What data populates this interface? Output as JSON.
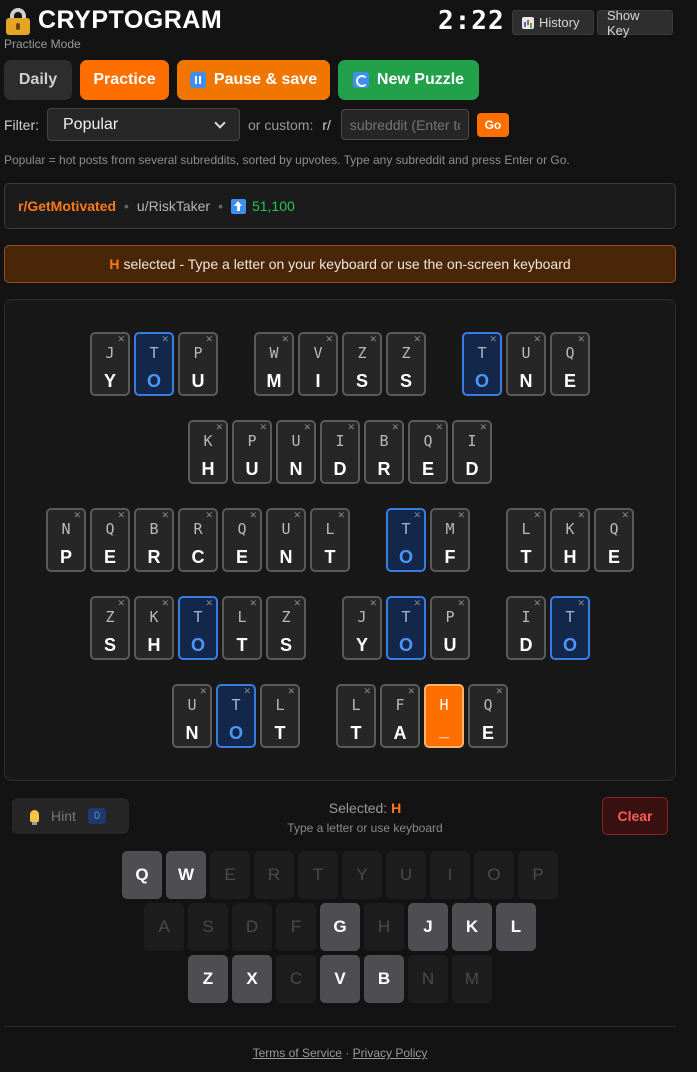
{
  "header": {
    "title": "CRYPTOGRAM",
    "mode_label": "Practice Mode",
    "timer": "2:22",
    "history_label": "History",
    "show_key_label": "Show Key"
  },
  "modes": {
    "daily": "Daily",
    "practice": "Practice",
    "pause_save": "Pause & save",
    "new_puzzle": "New Puzzle"
  },
  "filter": {
    "label": "Filter:",
    "selected": "Popular",
    "or_custom": "or custom:",
    "prefix": "r/",
    "custom_placeholder": "subreddit (Enter to",
    "go_label": "Go",
    "help_text": "Popular = hot posts from several subreddits, sorted by upvotes. Type any subreddit and press Enter or Go."
  },
  "post": {
    "subreddit": "r/GetMotivated",
    "user": "u/RiskTaker",
    "score": "51,100",
    "separator": "•"
  },
  "banner": {
    "letter": "H",
    "message": "selected - Type a letter on your keyboard or use the on-screen keyboard"
  },
  "puzzle_lines": [
    [
      [
        [
          "J",
          "Y"
        ],
        [
          "T",
          "O"
        ],
        [
          "P",
          "U"
        ]
      ],
      [
        [
          "W",
          "M"
        ],
        [
          "V",
          "I"
        ],
        [
          "Z",
          "S"
        ],
        [
          "Z",
          "S"
        ]
      ],
      [
        [
          "T",
          "O"
        ],
        [
          "U",
          "N"
        ],
        [
          "Q",
          "E"
        ]
      ]
    ],
    [
      [
        [
          "K",
          "H"
        ],
        [
          "P",
          "U"
        ],
        [
          "U",
          "N"
        ],
        [
          "I",
          "D"
        ],
        [
          "B",
          "R"
        ],
        [
          "Q",
          "E"
        ],
        [
          "I",
          "D"
        ]
      ]
    ],
    [
      [
        [
          "N",
          "P"
        ],
        [
          "Q",
          "E"
        ],
        [
          "B",
          "R"
        ],
        [
          "R",
          "C"
        ],
        [
          "Q",
          "E"
        ],
        [
          "U",
          "N"
        ],
        [
          "L",
          "T"
        ]
      ],
      [
        [
          "T",
          "O"
        ],
        [
          "M",
          "F"
        ]
      ],
      [
        [
          "L",
          "T"
        ],
        [
          "K",
          "H"
        ],
        [
          "Q",
          "E"
        ]
      ]
    ],
    [
      [
        [
          "Z",
          "S"
        ],
        [
          "K",
          "H"
        ],
        [
          "T",
          "O"
        ],
        [
          "L",
          "T"
        ],
        [
          "Z",
          "S"
        ]
      ],
      [
        [
          "J",
          "Y"
        ],
        [
          "T",
          "O"
        ],
        [
          "P",
          "U"
        ]
      ],
      [
        [
          "I",
          "D"
        ],
        [
          "T",
          "O"
        ]
      ]
    ],
    [
      [
        [
          "U",
          "N"
        ],
        [
          "T",
          "O"
        ],
        [
          "L",
          "T"
        ]
      ],
      [
        [
          "L",
          "T"
        ],
        [
          "F",
          "A"
        ],
        [
          "H",
          "_"
        ],
        [
          "Q",
          "E"
        ]
      ]
    ]
  ],
  "highlight_cipher": "T",
  "selected_tile": "4.1.2",
  "controls": {
    "hint_label": "Hint",
    "hint_count": "0",
    "selected_prefix": "Selected:",
    "selected_letter": "H",
    "instructions": "Type a letter or use keyboard",
    "clear_label": "Clear"
  },
  "keyboard": {
    "rows": [
      [
        "Q",
        "W",
        "E",
        "R",
        "T",
        "Y",
        "U",
        "I",
        "O",
        "P"
      ],
      [
        "A",
        "S",
        "D",
        "F",
        "G",
        "H",
        "J",
        "K",
        "L"
      ],
      [
        "Z",
        "X",
        "C",
        "V",
        "B",
        "N",
        "M"
      ]
    ],
    "active": [
      "Q",
      "W",
      "G",
      "J",
      "K",
      "L",
      "Z",
      "X",
      "V",
      "B"
    ]
  },
  "footer": {
    "terms": "Terms of Service",
    "sep": "·",
    "privacy": "Privacy Policy"
  },
  "colors": {
    "accent_orange": "#ff6f00",
    "highlight_blue": "#3a7be0",
    "new_puzzle_green": "#22a04a",
    "score_green": "#22c55e"
  }
}
